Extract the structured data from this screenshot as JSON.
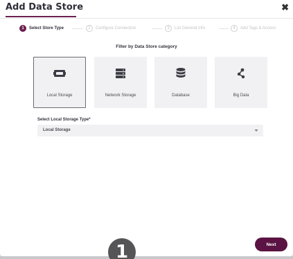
{
  "dialog": {
    "title": "Add Data Store",
    "close_glyph": "✖"
  },
  "steps": [
    {
      "number": "1",
      "label": "Select Store Type",
      "active": true
    },
    {
      "number": "2",
      "label": "Configure Connection",
      "active": false
    },
    {
      "number": "3",
      "label": "List General Info",
      "active": false
    },
    {
      "number": "4",
      "label": "Add Tags & Access",
      "active": false
    }
  ],
  "filter": {
    "label": "Filter by Data Store category",
    "categories": [
      {
        "label": "Local Storage",
        "icon": "local-storage-icon",
        "selected": true
      },
      {
        "label": "Network Storage",
        "icon": "network-storage-icon",
        "selected": false
      },
      {
        "label": "Database",
        "icon": "database-icon",
        "selected": false
      },
      {
        "label": "Big Data",
        "icon": "big-data-icon",
        "selected": false
      }
    ]
  },
  "local_storage_select": {
    "label": "Select Local Storage Type*",
    "value": "Local Storage"
  },
  "footer": {
    "next_label": "Next",
    "badge_number": "1"
  },
  "colors": {
    "accent": "#6d1f4f",
    "button": "#5a1342",
    "card_bg": "#f1f1f3",
    "icon": "#3c3c44"
  }
}
